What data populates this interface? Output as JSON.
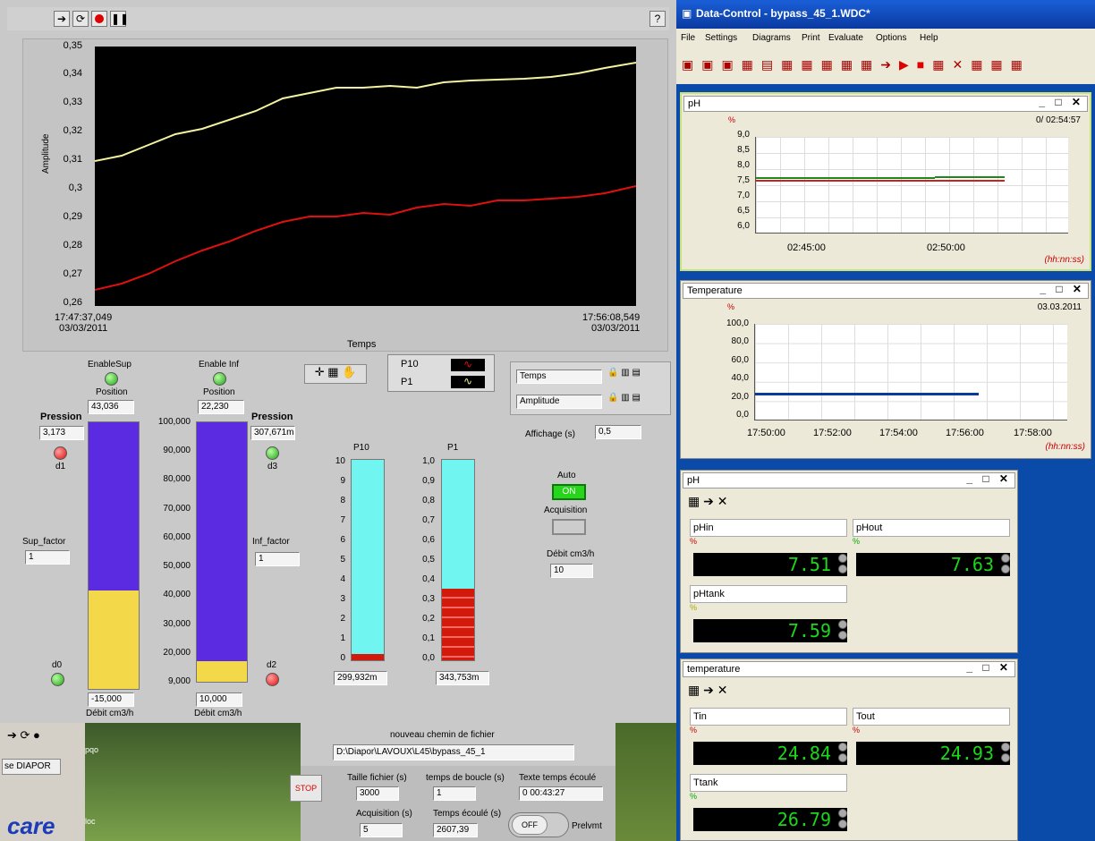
{
  "toolbar": {
    "help": "?"
  },
  "plot": {
    "yticks": [
      "0,35",
      "0,34",
      "0,33",
      "0,32",
      "0,31",
      "0,3",
      "0,29",
      "0,28",
      "0,27",
      "0,26"
    ],
    "ylabel": "Amplitude",
    "xlabel": "Temps",
    "xstart": "17:47:37,049",
    "xstart_date": "03/03/2011",
    "xend": "17:56:08,549",
    "xend_date": "03/03/2011"
  },
  "legend": {
    "p10": "P10",
    "p1": "P1"
  },
  "axes": {
    "x_name": "Temps",
    "y_name": "Amplitude"
  },
  "affichage": {
    "label": "Affichage (s)",
    "value": "0,5"
  },
  "sup": {
    "enable": "EnableSup",
    "position_label": "Position",
    "position": "43,036",
    "pression_label": "Pression",
    "pression": "3,173",
    "d1": "d1",
    "d0": "d0",
    "factor_label": "Sup_factor",
    "factor": "1",
    "debit": "-15,000",
    "debit_label": "Débit cm3/h",
    "level": 0.37
  },
  "inf": {
    "enable": "Enable Inf",
    "position_label": "Position",
    "position": "22,230",
    "pression_label": "Pression",
    "pression": "307,671m",
    "d3": "d3",
    "d2": "d2",
    "factor_label": "Inf_factor",
    "factor": "1",
    "debit": "10,000",
    "debit_label": "Débit cm3/h",
    "ticks": [
      "100,000",
      "90,000",
      "80,000",
      "70,000",
      "60,000",
      "50,000",
      "40,000",
      "30,000",
      "20,000",
      "9,000"
    ],
    "level": 0.08
  },
  "p10": {
    "label": "P10",
    "ticks": [
      "10",
      "9",
      "8",
      "7",
      "6",
      "5",
      "4",
      "3",
      "2",
      "1",
      "0"
    ],
    "value": "299,932m"
  },
  "p1": {
    "label": "P1",
    "ticks": [
      "1,0",
      "0,9",
      "0,8",
      "0,7",
      "0,6",
      "0,5",
      "0,4",
      "0,3",
      "0,2",
      "0,1",
      "0,0"
    ],
    "value": "343,753m"
  },
  "auto": {
    "label": "Auto",
    "state": "ON",
    "acq_label": "Acquisition",
    "debit_label": "Débit cm3/h",
    "debit": "10"
  },
  "bottom": {
    "chemin_label": "nouveau chemin de fichier",
    "chemin": "D:\\Diapor\\LAVOUX\\L45\\bypass_45_1",
    "stop": "STOP",
    "taille_label": "Taille fichier (s)",
    "taille": "3000",
    "boucle_label": "temps de boucle (s)",
    "boucle": "1",
    "texte_label": "Texte temps écoulé",
    "texte": "0 00:43:27",
    "acq_label": "Acquisition (s)",
    "acq": "5",
    "ecoule_label": "Temps écoulé (s)",
    "ecoule": "2607,39",
    "off": "OFF",
    "prelvmt": "Prelvmt",
    "diapor": "se DIAPOR",
    "logo": "care",
    "small": "loc",
    "pqo": "pqo"
  },
  "dc": {
    "title": "Data-Control - bypass_45_1.WDC*",
    "menu": [
      "File",
      "Settings",
      "Diagrams",
      "Print",
      "Evaluate",
      "Options",
      "Help"
    ]
  },
  "phchart": {
    "title": "pH",
    "unit": "%",
    "time": "0/ 02:54:57",
    "yticks": [
      "9,0",
      "8,5",
      "8,0",
      "7,5",
      "7,0",
      "6,5",
      "6,0"
    ],
    "xticks": [
      "02:45:00",
      "02:50:00"
    ],
    "xunit": "(hh:nn:ss)"
  },
  "tempchart": {
    "title": "Temperature",
    "unit": "%",
    "date": "03.03.2011",
    "yticks": [
      "100,0",
      "80,0",
      "60,0",
      "40,0",
      "20,0",
      "0,0"
    ],
    "xticks": [
      "17:50:00",
      "17:52:00",
      "17:54:00",
      "17:56:00",
      "17:58:00"
    ],
    "xunit": "(hh:nn:ss)"
  },
  "phpanel": {
    "title": "pH",
    "pHin": "pHin",
    "pHin_val": "7.51",
    "pHout": "pHout",
    "pHout_val": "7.63",
    "pHtank": "pHtank",
    "pHtank_val": "7.59",
    "unit": "%"
  },
  "temppanel": {
    "title": "temperature",
    "tin": "Tin",
    "tin_val": "24.84",
    "tout": "Tout",
    "tout_val": "24.93",
    "ttank": "Ttank",
    "ttank_val": "26.79",
    "unit": "%"
  }
}
